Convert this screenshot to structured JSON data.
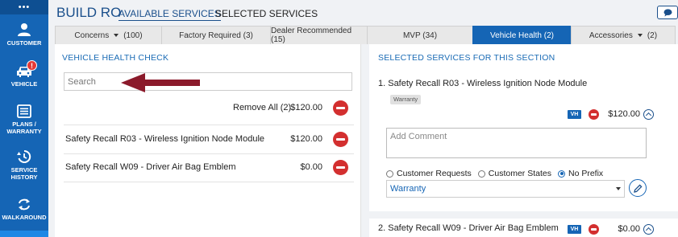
{
  "rail": {
    "top_label": "•••",
    "items": [
      {
        "label": "CUSTOMER",
        "icon": "person-icon"
      },
      {
        "label": "VEHICLE",
        "icon": "car-icon",
        "badge": "!"
      },
      {
        "label": "PLANS / WARRANTY",
        "icon": "list-icon"
      },
      {
        "label": "SERVICE HISTORY",
        "icon": "history-icon"
      },
      {
        "label": "WALKAROUND",
        "icon": "refresh-icon"
      }
    ]
  },
  "header": {
    "title": "BUILD RO",
    "links": [
      "AVAILABLE SERVICES",
      "SELECTED SERVICES"
    ]
  },
  "tabs": [
    {
      "label": "Concerns",
      "count": "(100)",
      "dropdown": true
    },
    {
      "label": "Factory Required (3)"
    },
    {
      "label": "Dealer Recommended (15)"
    },
    {
      "label": "MVP (34)"
    },
    {
      "label": "Vehicle Health (2)",
      "active": true
    },
    {
      "label": "Accessories",
      "count": "(2)",
      "dropdown": true
    }
  ],
  "left": {
    "title": "VEHICLE HEALTH CHECK",
    "search_placeholder": "Search",
    "remove_all": "Remove All (2)",
    "remove_all_amount": "$120.00",
    "items": [
      {
        "name": "Safety Recall R03 - Wireless Ignition Node Module",
        "amount": "$120.00"
      },
      {
        "name": "Safety Recall W09 - Driver Air Bag Emblem",
        "amount": "$0.00"
      }
    ]
  },
  "right": {
    "title": "SELECTED SERVICES FOR THIS SECTION",
    "services": [
      {
        "name": "1.  Safety Recall R03 - Wireless Ignition Node Module",
        "tag": "Warranty",
        "vh": "VH",
        "amount": "$120.00"
      },
      {
        "name": "2.  Safety Recall W09 - Driver Air Bag Emblem",
        "vh": "VH",
        "amount": "$0.00"
      }
    ],
    "comment_placeholder": "Add Comment",
    "radio_options": [
      "Customer Requests",
      "Customer States",
      "No Prefix"
    ],
    "radio_selected": "No Prefix",
    "pay_type": "Warranty"
  },
  "colors": {
    "rail": "#1565b5",
    "accent": "#1a4f8b",
    "remove": "#d32f2f",
    "arrow": "#8b1a2b"
  }
}
